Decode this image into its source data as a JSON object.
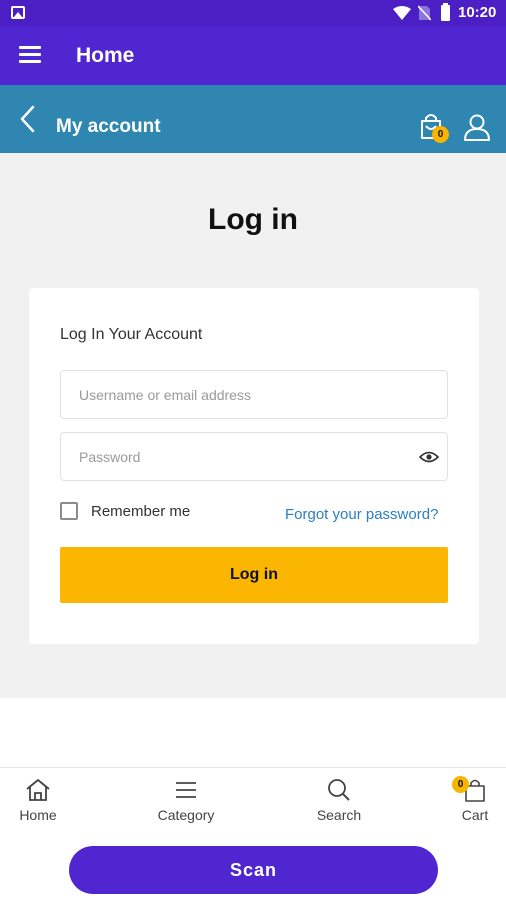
{
  "status_bar": {
    "time": "10:20"
  },
  "app_bar": {
    "title": "Home"
  },
  "sub_bar": {
    "title": "My account",
    "cart_count": "0"
  },
  "page": {
    "title": "Log in"
  },
  "login_form": {
    "heading": "Log In Your Account",
    "username_placeholder": "Username or email address",
    "password_placeholder": "Password",
    "remember_label": "Remember me",
    "forgot_label": "Forgot your password?",
    "submit_label": "Log in"
  },
  "bottom_nav": {
    "items": [
      {
        "label": "Home",
        "icon": "home-icon"
      },
      {
        "label": "Category",
        "icon": "menu-lines-icon"
      },
      {
        "label": "Search",
        "icon": "search-icon"
      },
      {
        "label": "Cart",
        "icon": "bag-icon"
      }
    ],
    "cart_count": "0",
    "scan_label": "Scan"
  },
  "colors": {
    "status_bar": "#4b1fc4",
    "app_bar": "#5026d1",
    "sub_bar": "#2f86b0",
    "accent": "#fab600",
    "link": "#2a7fc0",
    "scan_button": "#5026d1"
  }
}
